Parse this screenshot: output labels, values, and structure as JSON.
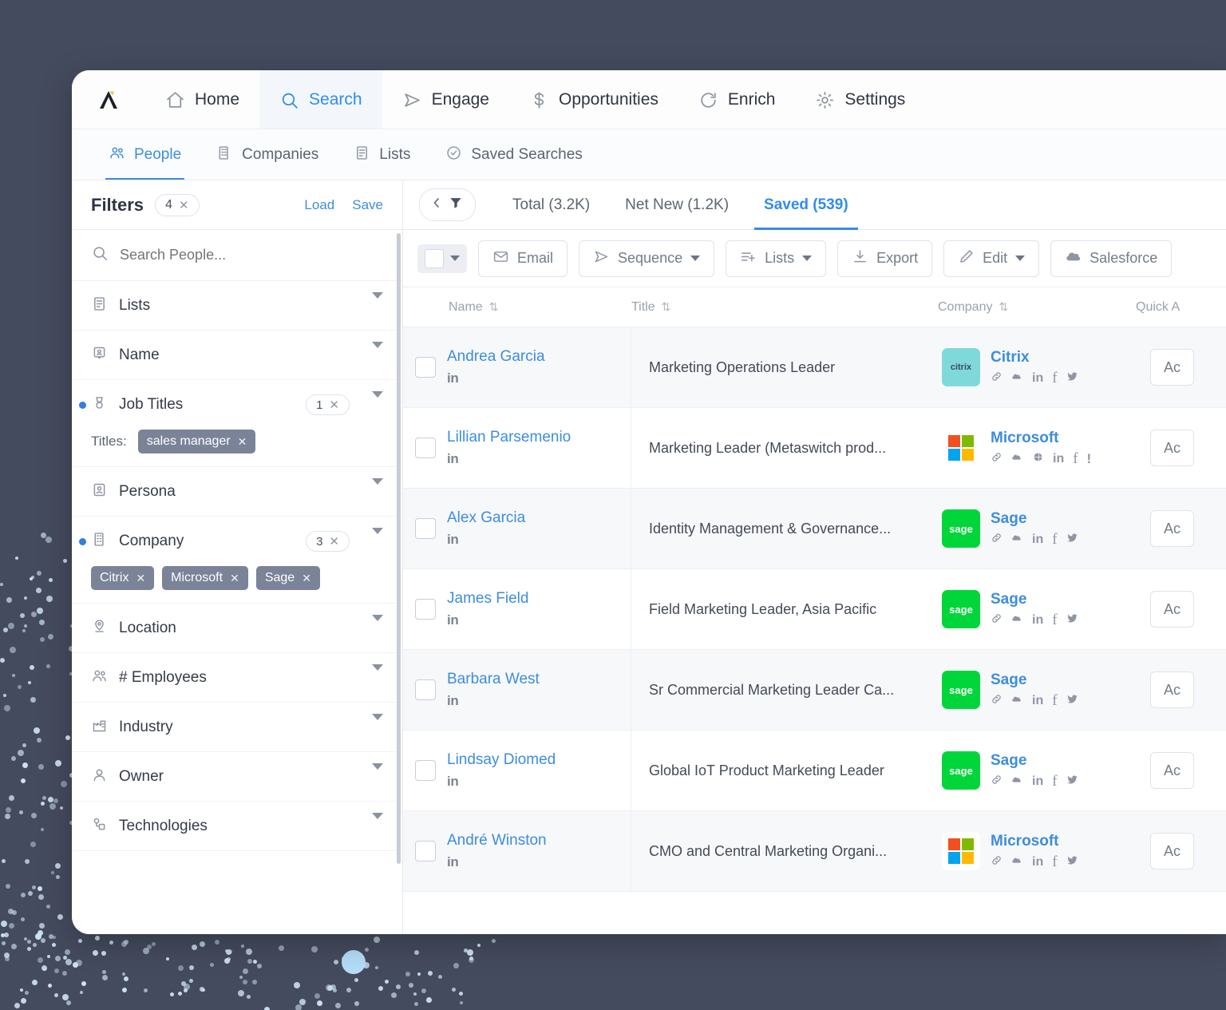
{
  "brand": {
    "logo_name": "apollo-logo",
    "accent": "#2f8cf0",
    "dark_bg": "#454b5e"
  },
  "topnav": {
    "items": [
      {
        "label": "Home",
        "icon": "home-icon",
        "active": false
      },
      {
        "label": "Search",
        "icon": "search-icon",
        "active": true
      },
      {
        "label": "Engage",
        "icon": "send-icon",
        "active": false
      },
      {
        "label": "Opportunities",
        "icon": "dollar-icon",
        "active": false
      },
      {
        "label": "Enrich",
        "icon": "refresh-icon",
        "active": false
      },
      {
        "label": "Settings",
        "icon": "gear-icon",
        "active": false
      }
    ]
  },
  "subnav": {
    "items": [
      {
        "label": "People",
        "icon": "people-icon",
        "active": true
      },
      {
        "label": "Companies",
        "icon": "building-icon",
        "active": false
      },
      {
        "label": "Lists",
        "icon": "list-icon",
        "active": false
      },
      {
        "label": "Saved Searches",
        "icon": "check-circle-icon",
        "active": false
      }
    ]
  },
  "sidebar": {
    "title": "Filters",
    "active_count": "4",
    "clear_glyph": "✕",
    "load_label": "Load",
    "save_label": "Save",
    "search_placeholder": "Search People...",
    "titles_label": "Titles:",
    "job_title_tags": [
      "sales manager"
    ],
    "company_tags": [
      "Citrix",
      "Microsoft",
      "Sage"
    ],
    "filters": [
      {
        "label": "Lists",
        "icon": "list-icon",
        "count": "",
        "dot": false
      },
      {
        "label": "Name",
        "icon": "id-card-icon",
        "count": "",
        "dot": false
      },
      {
        "label": "Job Titles",
        "icon": "badge-icon",
        "count": "1",
        "dot": true
      },
      {
        "label": "Persona",
        "icon": "persona-icon",
        "count": "",
        "dot": false
      },
      {
        "label": "Company",
        "icon": "building-icon",
        "count": "3",
        "dot": true
      },
      {
        "label": "Location",
        "icon": "pin-icon",
        "count": "",
        "dot": false
      },
      {
        "label": "# Employees",
        "icon": "people-icon",
        "count": "",
        "dot": false
      },
      {
        "label": "Industry",
        "icon": "factory-icon",
        "count": "",
        "dot": false
      },
      {
        "label": "Owner",
        "icon": "user-icon",
        "count": "",
        "dot": false
      },
      {
        "label": "Technologies",
        "icon": "tech-icon",
        "count": "",
        "dot": false
      }
    ]
  },
  "results": {
    "collapse_icon": "collapse-filter-icon",
    "tabs": [
      {
        "label": "Total (3.2K)",
        "active": false
      },
      {
        "label": "Net New (1.2K)",
        "active": false
      },
      {
        "label": "Saved (539)",
        "active": true
      }
    ],
    "toolbar": [
      {
        "label": "Email",
        "icon": "envelope-icon",
        "caret": false
      },
      {
        "label": "Sequence",
        "icon": "send-icon",
        "caret": true
      },
      {
        "label": "Lists",
        "icon": "list-add-icon",
        "caret": true
      },
      {
        "label": "Export",
        "icon": "download-icon",
        "caret": false
      },
      {
        "label": "Edit",
        "icon": "pencil-icon",
        "caret": true
      },
      {
        "label": "Salesforce",
        "icon": "cloud-icon",
        "caret": false
      }
    ],
    "columns": [
      {
        "label": "Name",
        "sortable": true
      },
      {
        "label": "Title",
        "sortable": true
      },
      {
        "label": "Company",
        "sortable": true
      },
      {
        "label": "Quick A",
        "sortable": false
      }
    ],
    "action_label": "Ac",
    "linkedin_label": "in",
    "rows": [
      {
        "name": "Andrea Garcia",
        "title": "Marketing Operations Leader",
        "company": "Citrix",
        "logo": "citrix",
        "logo_text": "citrix",
        "socials": [
          "link",
          "cloud",
          "linkedin",
          "facebook",
          "twitter"
        ]
      },
      {
        "name": "Lillian Parsemenio",
        "title": "Marketing Leader (Metaswitch prod...",
        "company": "Microsoft",
        "logo": "ms",
        "logo_text": "",
        "socials": [
          "link",
          "cloud",
          "globe",
          "linkedin",
          "facebook",
          "more"
        ]
      },
      {
        "name": "Alex Garcia",
        "title": "Identity Management & Governance...",
        "company": "Sage",
        "logo": "sage",
        "logo_text": "sage",
        "socials": [
          "link",
          "cloud",
          "linkedin",
          "facebook",
          "twitter"
        ]
      },
      {
        "name": "James Field",
        "title": "Field Marketing Leader, Asia Pacific",
        "company": "Sage",
        "logo": "sage",
        "logo_text": "sage",
        "socials": [
          "link",
          "cloud",
          "linkedin",
          "facebook",
          "twitter"
        ]
      },
      {
        "name": "Barbara West",
        "title": "Sr Commercial Marketing Leader Ca...",
        "company": "Sage",
        "logo": "sage",
        "logo_text": "sage",
        "socials": [
          "link",
          "cloud",
          "linkedin",
          "facebook",
          "twitter"
        ]
      },
      {
        "name": "Lindsay Diomed",
        "title": "Global IoT Product Marketing Leader",
        "company": "Sage",
        "logo": "sage",
        "logo_text": "sage",
        "socials": [
          "link",
          "cloud",
          "linkedin",
          "facebook",
          "twitter"
        ]
      },
      {
        "name": "André Winston",
        "title": "CMO and Central Marketing Organi...",
        "company": "Microsoft",
        "logo": "ms",
        "logo_text": "",
        "socials": [
          "link",
          "cloud",
          "linkedin",
          "facebook",
          "twitter"
        ]
      }
    ]
  }
}
